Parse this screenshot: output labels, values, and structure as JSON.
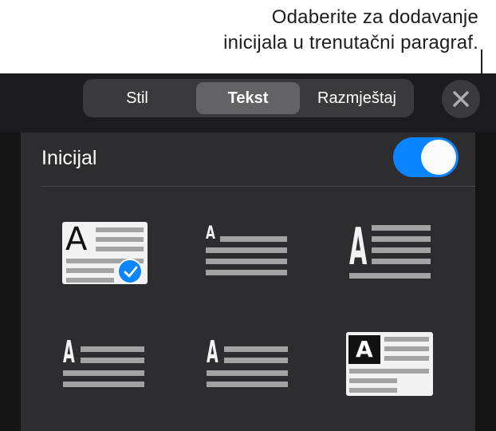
{
  "callout": {
    "line1": "Odaberite za dodavanje",
    "line2": "inicijala u trenutačni paragraf."
  },
  "tabs": [
    {
      "label": "Stil",
      "active": false
    },
    {
      "label": "Tekst",
      "active": true
    },
    {
      "label": "Razmještaj",
      "active": false
    }
  ],
  "close_icon": "close-icon",
  "drop_cap": {
    "label": "Inicijal",
    "enabled": true,
    "accent_color": "#0a84ff"
  },
  "styles": {
    "selected_index": 0,
    "items": [
      {
        "letter": "A"
      },
      {
        "letter": "A"
      },
      {
        "letter": "A"
      },
      {
        "letter": "A"
      },
      {
        "letter": "A"
      },
      {
        "letter": "A"
      }
    ]
  }
}
